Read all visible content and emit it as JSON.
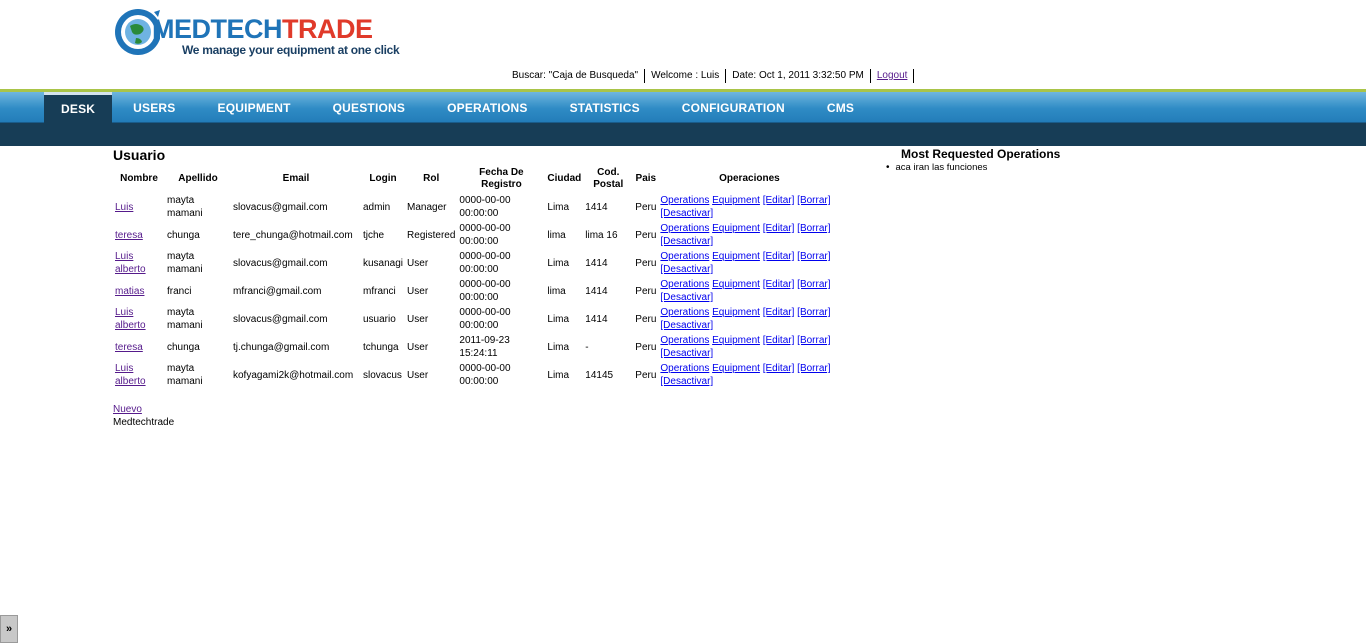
{
  "brand": {
    "name_part1": "MEDTECH",
    "name_part2": "TRADE",
    "tagline": "We manage your equipment at one click"
  },
  "info_bar": {
    "search": "Buscar: \"Caja de Busqueda\"",
    "welcome": "Welcome : Luis",
    "date": "Date: Oct 1, 2011 3:32:50 PM",
    "logout": "Logout"
  },
  "nav": {
    "tabs": [
      "DESK",
      "USERS",
      "EQUIPMENT",
      "QUESTIONS",
      "OPERATIONS",
      "STATISTICS",
      "CONFIGURATION",
      "CMS"
    ],
    "active": "DESK"
  },
  "users": {
    "title": "Usuario",
    "headers": {
      "nombre": "Nombre",
      "apellido": "Apellido",
      "email": "Email",
      "login": "Login",
      "rol": "Rol",
      "fecha": "Fecha De Registro",
      "ciudad": "Ciudad",
      "cod_postal": "Cod. Postal",
      "pais": "Pais",
      "operaciones": "Operaciones"
    },
    "op_labels": {
      "operations": "Operations",
      "equipment": "Equipment",
      "editar": "[Editar]",
      "borrar": "[Borrar]",
      "desactivar": "[Desactivar]"
    },
    "rows": [
      {
        "nombre": "Luis",
        "apellido": "mayta mamani",
        "email": "slovacus@gmail.com",
        "login": "admin",
        "rol": "Manager",
        "fecha": "0000-00-00 00:00:00",
        "ciudad": "Lima",
        "cod_postal": "1414",
        "pais": "Peru"
      },
      {
        "nombre": "teresa",
        "apellido": "chunga",
        "email": "tere_chunga@hotmail.com",
        "login": "tjche",
        "rol": "Registered",
        "fecha": "0000-00-00 00:00:00",
        "ciudad": "lima",
        "cod_postal": "lima 16",
        "pais": "Peru"
      },
      {
        "nombre": "Luis alberto",
        "apellido": "mayta mamani",
        "email": "slovacus@gmail.com",
        "login": "kusanagi",
        "rol": "User",
        "fecha": "0000-00-00 00:00:00",
        "ciudad": "Lima",
        "cod_postal": "1414",
        "pais": "Peru"
      },
      {
        "nombre": "matias",
        "apellido": "franci",
        "email": "mfranci@gmail.com",
        "login": "mfranci",
        "rol": "User",
        "fecha": "0000-00-00 00:00:00",
        "ciudad": "lima",
        "cod_postal": "1414",
        "pais": "Peru"
      },
      {
        "nombre": "Luis alberto",
        "apellido": "mayta mamani",
        "email": "slovacus@gmail.com",
        "login": "usuario",
        "rol": "User",
        "fecha": "0000-00-00 00:00:00",
        "ciudad": "Lima",
        "cod_postal": "1414",
        "pais": "Peru"
      },
      {
        "nombre": "teresa",
        "apellido": "chunga",
        "email": "tj.chunga@gmail.com",
        "login": "tchunga",
        "rol": "User",
        "fecha": "2011-09-23 15:24:11",
        "ciudad": "Lima",
        "cod_postal": "-",
        "pais": "Peru"
      },
      {
        "nombre": "Luis alberto",
        "apellido": "mayta mamani",
        "email": "kofyagami2k@hotmail.com",
        "login": "slovacus",
        "rol": "User",
        "fecha": "0000-00-00 00:00:00",
        "ciudad": "Lima",
        "cod_postal": "14145",
        "pais": "Peru"
      }
    ],
    "new_link": "Nuevo",
    "footer": "Medtechtrade"
  },
  "sidebar": {
    "title": "Most Requested Operations",
    "items": [
      "aca iran las funciones"
    ]
  },
  "toggle": {
    "label": "»"
  },
  "colors": {
    "brand_blue": "#1f74b8",
    "brand_red": "#e03a2a",
    "nav_blue": "#2f8bc5",
    "nav_dark": "#173d56",
    "accent_green": "#a9c448"
  }
}
